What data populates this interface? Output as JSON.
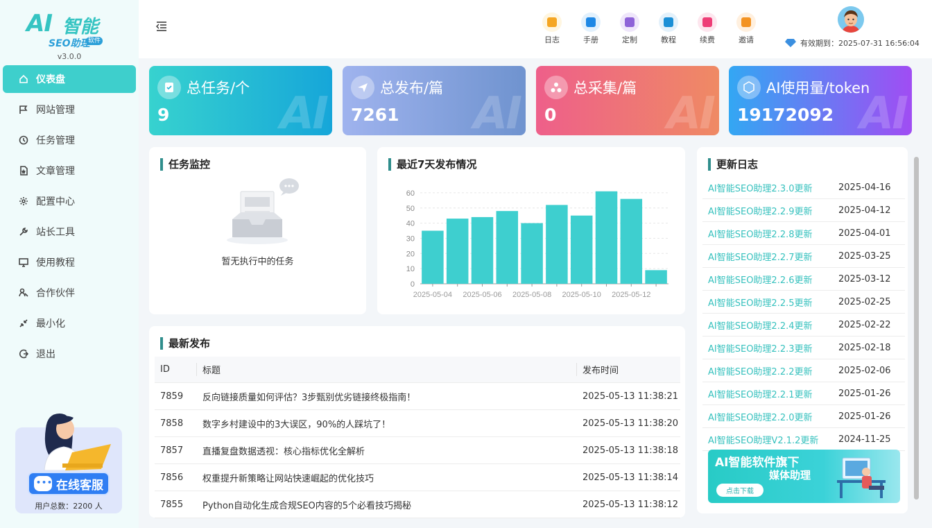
{
  "brand": {
    "logo_ai": "AI",
    "logo_cn": "智能",
    "logo_seo": "SEO助理",
    "logo_tag": "软件",
    "version": "v3.0.0"
  },
  "menu": [
    {
      "label": "仪表盘",
      "icon": "home-icon",
      "active": true
    },
    {
      "label": "网站管理",
      "icon": "flag-icon"
    },
    {
      "label": "任务管理",
      "icon": "clock-icon"
    },
    {
      "label": "文章管理",
      "icon": "document-icon"
    },
    {
      "label": "配置中心",
      "icon": "gear-icon"
    },
    {
      "label": "站长工具",
      "icon": "wrench-icon"
    },
    {
      "label": "使用教程",
      "icon": "monitor-icon"
    },
    {
      "label": "合作伙伴",
      "icon": "partner-icon"
    },
    {
      "label": "最小化",
      "icon": "minimize-icon"
    },
    {
      "label": "退出",
      "icon": "logout-icon"
    }
  ],
  "support": {
    "button": "在线客服",
    "users": "用户总数：2200 人"
  },
  "topbar": {
    "quick": [
      {
        "label": "日志",
        "bg": "#fff6e0",
        "fg": "#f5a623"
      },
      {
        "label": "手册",
        "bg": "#e2f1fd",
        "fg": "#1e88e5"
      },
      {
        "label": "定制",
        "bg": "#efe6fb",
        "fg": "#8e63d8"
      },
      {
        "label": "教程",
        "bg": "#e3f1fb",
        "fg": "#1b8fd6"
      },
      {
        "label": "续费",
        "bg": "#fde6ee",
        "fg": "#ee3e77"
      },
      {
        "label": "邀请",
        "bg": "#fff0df",
        "fg": "#f39323"
      }
    ],
    "expiry": "有效期到：2025-07-31 16:56:04"
  },
  "stats": [
    {
      "title": "总任务/个",
      "value": "9",
      "wm": "AI",
      "icon": "task-check-icon"
    },
    {
      "title": "总发布/篇",
      "value": "7261",
      "wm": "AI",
      "icon": "send-icon"
    },
    {
      "title": "总采集/篇",
      "value": "0",
      "wm": "AI",
      "icon": "collect-icon"
    },
    {
      "title": "AI使用量/token",
      "value": "19172092",
      "wm": "AI",
      "icon": "ai-usage-icon"
    }
  ],
  "monitor": {
    "title": "任务监控",
    "empty": "暂无执行中的任务"
  },
  "chart_data": {
    "type": "bar",
    "title": "最近7天发布情况",
    "categories": [
      "2025-05-04",
      "2025-05-05",
      "2025-05-06",
      "2025-05-07",
      "2025-05-08",
      "2025-05-09",
      "2025-05-10",
      "2025-05-11",
      "2025-05-12",
      "2025-05-13"
    ],
    "tick_labels": [
      "2025-05-04",
      "2025-05-06",
      "2025-05-08",
      "2025-05-10",
      "2025-05-12"
    ],
    "values": [
      35,
      43,
      44,
      48,
      40,
      52,
      45,
      61,
      56,
      9
    ],
    "yticks": [
      0,
      10,
      20,
      30,
      40,
      50,
      60
    ],
    "ylim": [
      0,
      65
    ],
    "color": "#3ecfcf"
  },
  "recent": {
    "title": "最新发布",
    "headers": [
      "ID",
      "标题",
      "发布时间"
    ],
    "rows": [
      [
        "7859",
        "反向链接质量如何评估？3步甄别优劣链接终极指南！",
        "2025-05-13 11:38:21"
      ],
      [
        "7858",
        "数字乡村建设中的3大误区，90%的人踩坑了！",
        "2025-05-13 11:38:20"
      ],
      [
        "7857",
        "直播复盘数据透视：核心指标优化全解析",
        "2025-05-13 11:38:18"
      ],
      [
        "7856",
        "权重提升新策略让网站快速崛起的优化技巧",
        "2025-05-13 11:38:14"
      ],
      [
        "7855",
        "Python自动化生成合规SEO内容的5个必看技巧揭秘",
        "2025-05-13 11:38:12"
      ]
    ]
  },
  "changelog": {
    "title": "更新日志",
    "items": [
      [
        "AI智能SEO助理2.3.0更新",
        "2025-04-16"
      ],
      [
        "AI智能SEO助理2.2.9更新",
        "2025-04-12"
      ],
      [
        "AI智能SEO助理2.2.8更新",
        "2025-04-01"
      ],
      [
        "AI智能SEO助理2.2.7更新",
        "2025-03-25"
      ],
      [
        "AI智能SEO助理2.2.6更新",
        "2025-03-12"
      ],
      [
        "AI智能SEO助理2.2.5更新",
        "2025-02-25"
      ],
      [
        "AI智能SEO助理2.2.4更新",
        "2025-02-22"
      ],
      [
        "AI智能SEO助理2.2.3更新",
        "2025-02-18"
      ],
      [
        "AI智能SEO助理2.2.2更新",
        "2025-02-06"
      ],
      [
        "AI智能SEO助理2.2.1更新",
        "2025-01-26"
      ],
      [
        "AI智能SEO助理2.2.0更新",
        "2025-01-26"
      ],
      [
        "AI智能SEO助理V2.1.2更新",
        "2024-11-25"
      ]
    ]
  },
  "banner": {
    "line1": "AI智能软件旗下",
    "line2": "媒体助理",
    "button": "点击下载"
  }
}
